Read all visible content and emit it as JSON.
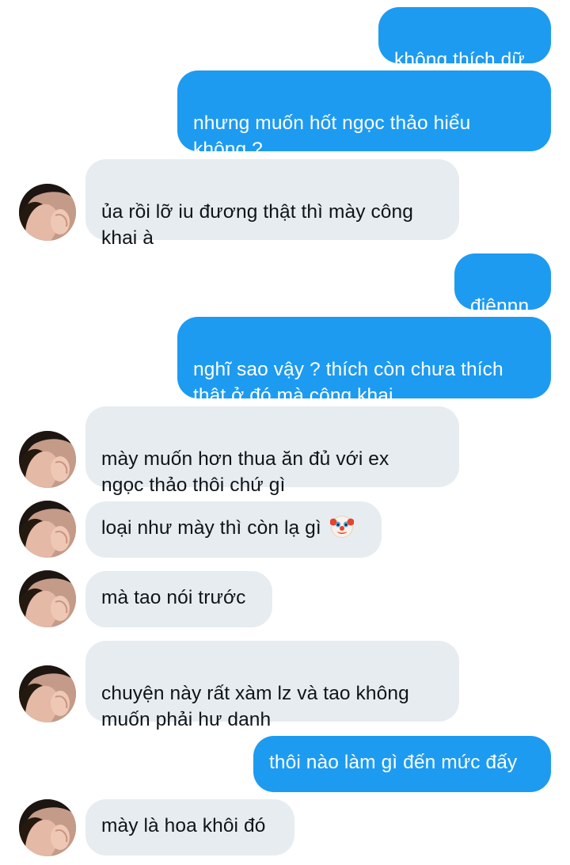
{
  "messages": [
    {
      "side": "out",
      "text": "không thích dữ"
    },
    {
      "side": "out",
      "text": "nhưng muốn hốt ngọc thảo hiểu\nkhông ?"
    },
    {
      "side": "in",
      "text": "ủa rồi lỡ iu đương thật thì mày công\nkhai à"
    },
    {
      "side": "out",
      "text": "điênnn"
    },
    {
      "side": "out",
      "text": "nghĩ sao vậy ? thích còn chưa thích\nthật ở đó mà công khai"
    },
    {
      "side": "in",
      "text": "mày muốn hơn thua ăn đủ với ex\nngọc thảo thôi chứ gì"
    },
    {
      "side": "in",
      "text": "loại như mày thì còn lạ gì",
      "emoji": "clown-face"
    },
    {
      "side": "in",
      "text": "mà tao nói trước"
    },
    {
      "side": "in",
      "text": "chuyện này rất xàm lz và tao không\nmuốn phải hư danh"
    },
    {
      "side": "out",
      "text": "thôi nào làm gì đến mức đấy"
    },
    {
      "side": "in",
      "text": "mày là hoa khôi đó"
    }
  ],
  "colors": {
    "outgoing_bubble": "#1d9bf0",
    "incoming_bubble": "#e7ecf0",
    "outgoing_text": "#ffffff",
    "incoming_text": "#0f1419"
  }
}
